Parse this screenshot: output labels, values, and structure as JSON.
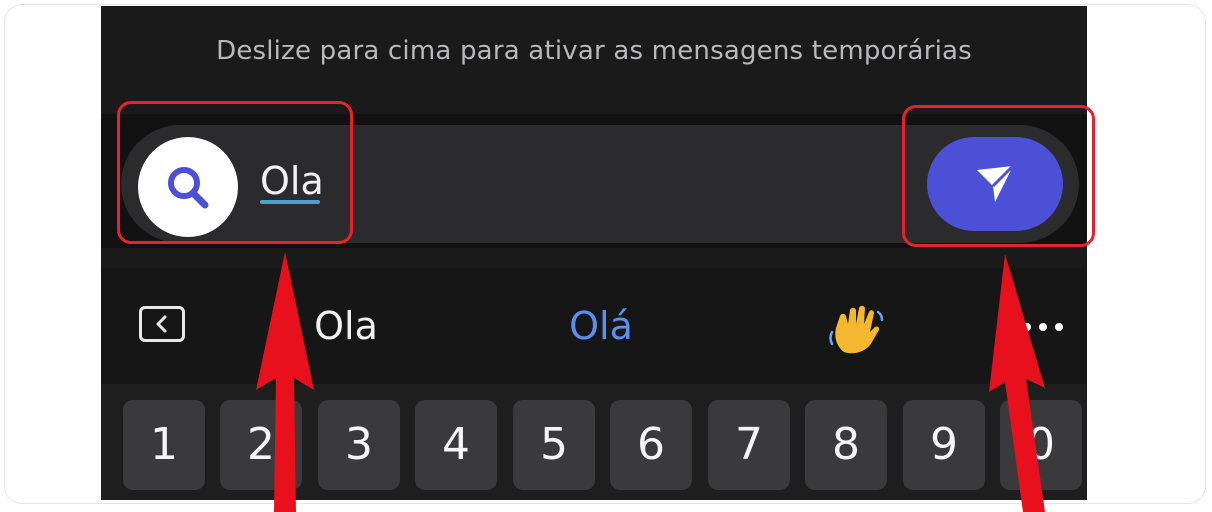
{
  "hint": {
    "text": "Deslize para cima para ativar as mensagens temporárias"
  },
  "composer": {
    "left_button_icon": "search-icon",
    "message_text": "Ola",
    "send_button_icon": "send-icon"
  },
  "suggestions": {
    "back_icon": "chevron-left-icon",
    "items": [
      "Ola",
      "Olá",
      "👋"
    ],
    "more_icon": "more-horizontal-icon"
  },
  "keyboard": {
    "number_row": [
      "1",
      "2",
      "3",
      "4",
      "5",
      "6",
      "7",
      "8",
      "9",
      "0"
    ]
  },
  "colors": {
    "highlight": "#e8222d",
    "send_button": "#4b50d6",
    "search_icon": "#4b50d6",
    "suggestion_accent": "#5a8ff0"
  }
}
